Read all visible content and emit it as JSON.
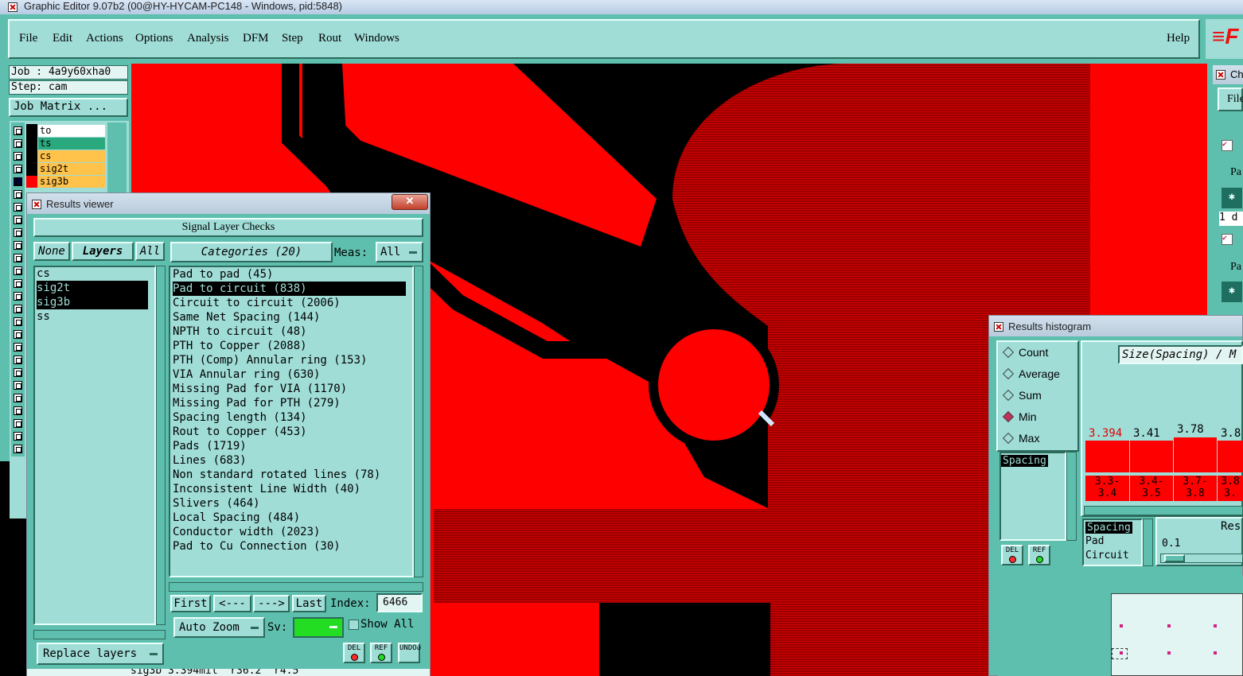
{
  "window": {
    "title": "Graphic Editor 9.07b2 (00@HY-HYCAM-PC148 - Windows, pid:5848)"
  },
  "menu": {
    "items": [
      "File",
      "Edit",
      "Actions",
      "Options",
      "Analysis",
      "DFM",
      "Step",
      "Rout",
      "Windows"
    ],
    "help": "Help",
    "logo": "≡F"
  },
  "job": {
    "job": "Job : 4a9y60xha0",
    "step": "Step: cam",
    "matrix_button": "Job Matrix ..."
  },
  "layers": [
    {
      "name": "to",
      "color": "#ffffff"
    },
    {
      "name": "ts",
      "color": "#2aa87e"
    },
    {
      "name": "cs",
      "color": "#ffc24a"
    },
    {
      "name": "sig2t",
      "color": "#ffc24a"
    },
    {
      "name": "sig3b",
      "color": "#ffc24a"
    }
  ],
  "results_viewer": {
    "title": "Results viewer",
    "header": "Signal Layer Checks",
    "none": "None",
    "layers_btn": "Layers",
    "all": "All",
    "categories_btn": "Categories (20)",
    "meas_label": "Meas:",
    "meas_value": "All",
    "layer_list": [
      "cs",
      "sig2t",
      "sig3b",
      "ss"
    ],
    "categories": [
      "Pad to pad (45)",
      "Pad to circuit (838)",
      "Circuit to circuit (2006)",
      "Same Net Spacing (144)",
      "NPTH to circuit (48)",
      "PTH to Copper (2088)",
      "PTH (Comp) Annular ring (153)",
      "VIA Annular ring (630)",
      "Missing Pad for VIA (1170)",
      "Missing Pad for PTH (279)",
      "Spacing length (134)",
      "Rout to Copper (453)",
      "Pads (1719)",
      "Lines (683)",
      "Non standard rotated lines (78)",
      "Inconsistent Line Width (40)",
      "Slivers (464)",
      "Local Spacing (484)",
      "Conductor width (2023)",
      "Pad to Cu Connection (30)"
    ],
    "first": "First",
    "prev": "<---",
    "next": "--->",
    "last": "Last",
    "index_label": "Index:",
    "index_value": "6466",
    "auto_zoom": "Auto Zoom",
    "sv_label": "Sv:",
    "show_all": "Show All",
    "replace_layers": "Replace layers",
    "del": "DEL",
    "ref": "REF",
    "undo": "UNDO",
    "status": "sig3b 3.394mil  r36.2  r4.5"
  },
  "histogram": {
    "title": "Results histogram",
    "options": [
      "Count",
      "Average",
      "Sum",
      "Min",
      "Max"
    ],
    "selected_option": "Min",
    "attr_list": [
      "Spacing"
    ],
    "size_field": "Size(Spacing) / M",
    "bar_values": [
      "3.394",
      "3.41",
      "3.78",
      "3.8"
    ],
    "bar_ranges": [
      [
        "3.3-",
        "3.4"
      ],
      [
        "3.4-",
        "3.5"
      ],
      [
        "3.7-",
        "3.8"
      ],
      [
        "3.8",
        "3."
      ]
    ],
    "lower_list": [
      "Spacing",
      "Pad",
      "Circuit"
    ],
    "res_label": "Res",
    "res_value": "0.1",
    "del": "DEL",
    "ref": "REF"
  },
  "right_panel": {
    "title": "Ch",
    "file": "File",
    "pa": "Pa",
    "row1": "1 d"
  },
  "colors": {
    "copper": "#ff0000",
    "teal": "#5fbfae",
    "light_teal": "#a0ddd7",
    "selection": "#000000",
    "green_swatch": "#22dd22"
  }
}
